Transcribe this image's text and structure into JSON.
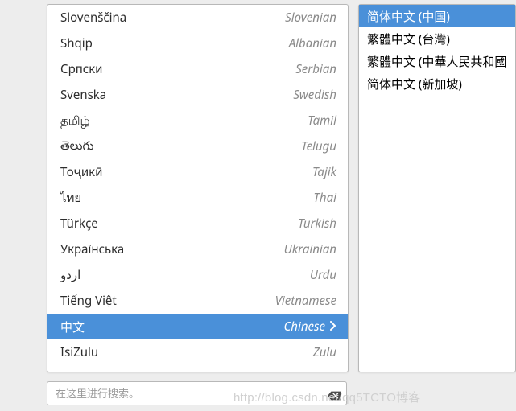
{
  "languages": [
    {
      "native": "Slovenščina",
      "english": "Slovenian"
    },
    {
      "native": "Shqip",
      "english": "Albanian"
    },
    {
      "native": "Српски",
      "english": "Serbian"
    },
    {
      "native": "Svenska",
      "english": "Swedish"
    },
    {
      "native": "தமிழ்",
      "english": "Tamil"
    },
    {
      "native": "తెలుగు",
      "english": "Telugu"
    },
    {
      "native": "Тоҷикӣ",
      "english": "Tajik"
    },
    {
      "native": "ไทย",
      "english": "Thai"
    },
    {
      "native": "Türkçe",
      "english": "Turkish"
    },
    {
      "native": "Українська",
      "english": "Ukrainian"
    },
    {
      "native": "اردو",
      "english": "Urdu"
    },
    {
      "native": "Tiếng Việt",
      "english": "Vietnamese"
    },
    {
      "native": "中文",
      "english": "Chinese",
      "selected": true
    },
    {
      "native": "IsiZulu",
      "english": "Zulu"
    }
  ],
  "variants": [
    {
      "label": "简体中文 (中国)",
      "selected": true
    },
    {
      "label": "繁體中文 (台灣)"
    },
    {
      "label": "繁體中文 (中華人民共和國"
    },
    {
      "label": "简体中文 (新加坡)"
    }
  ],
  "search": {
    "placeholder": "在这里进行搜索。"
  },
  "watermark": "http://blog.csdn.net/qq5TCTO博客"
}
